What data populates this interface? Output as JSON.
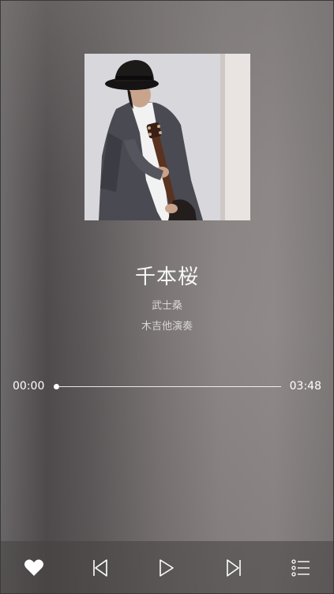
{
  "song": {
    "title": "千本桜",
    "artist": "武士桑",
    "album": "木吉他演奏"
  },
  "progress": {
    "current": "00:00",
    "duration": "03:48",
    "fraction": 0.0
  },
  "controls": {
    "like_icon": "heart-icon",
    "prev_icon": "skip-previous-icon",
    "play_icon": "play-icon",
    "next_icon": "skip-next-icon",
    "playlist_icon": "playlist-icon"
  },
  "colors": {
    "text": "#ffffff",
    "subtext": "#d8d6d6",
    "control_bar": "#464242"
  }
}
